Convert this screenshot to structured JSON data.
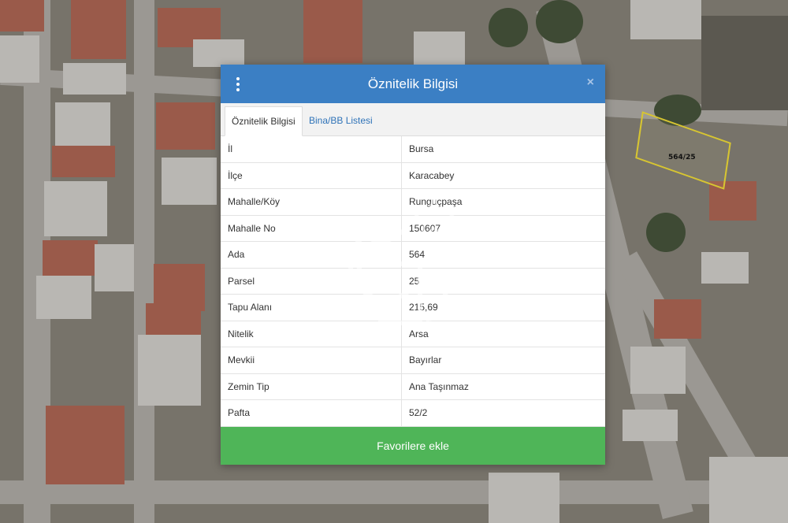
{
  "dialog": {
    "title": "Öznitelik Bilgisi",
    "close_symbol": "×",
    "tabs": [
      {
        "label": "Öznitelik Bilgisi",
        "active": true
      },
      {
        "label": "Bina/BB Listesi",
        "active": false
      }
    ],
    "rows": [
      {
        "key": "İl",
        "value": "Bursa"
      },
      {
        "key": "İlçe",
        "value": "Karacabey"
      },
      {
        "key": "Mahalle/Köy",
        "value": "Runguçpaşa"
      },
      {
        "key": "Mahalle No",
        "value": "150607"
      },
      {
        "key": "Ada",
        "value": "564"
      },
      {
        "key": "Parsel",
        "value": "25"
      },
      {
        "key": "Tapu Alanı",
        "value": "215,69"
      },
      {
        "key": "Nitelik",
        "value": "Arsa"
      },
      {
        "key": "Mevkii",
        "value": "Bayırlar"
      },
      {
        "key": "Zemin Tip",
        "value": "Ana Taşınmaz"
      },
      {
        "key": "Pafta",
        "value": "52/2"
      }
    ],
    "favorite_button": "Favorilere ekle"
  },
  "map": {
    "parcel_label": "564/25"
  },
  "watermark": {
    "suffix": "SM"
  },
  "colors": {
    "header": "#3b7fc4",
    "button": "#4fb558",
    "parcel_outline": "#d7c531"
  }
}
